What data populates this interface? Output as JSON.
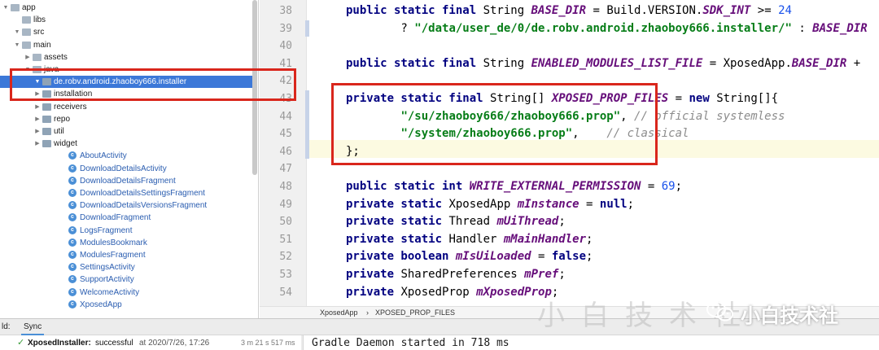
{
  "project_tree": {
    "items": [
      {
        "label": "app",
        "arrow": "▼",
        "icon": "folder-icon",
        "depth": 0
      },
      {
        "label": "libs",
        "arrow": "",
        "icon": "folder-icon",
        "depth": 1
      },
      {
        "label": "src",
        "arrow": "▼",
        "icon": "folder-icon",
        "depth": 1
      },
      {
        "label": "main",
        "arrow": "▼",
        "icon": "folder-icon",
        "depth": 2
      },
      {
        "label": "assets",
        "arrow": "▶",
        "icon": "assets-folder-icon",
        "depth": 3
      },
      {
        "label": "java",
        "arrow": "▼",
        "icon": "source-folder-icon",
        "depth": 3
      },
      {
        "label": "de.robv.android.zhaoboy666.installer",
        "arrow": "▼",
        "icon": "package-icon",
        "depth": 4,
        "selected": true
      },
      {
        "label": "installation",
        "arrow": "▶",
        "icon": "package-icon",
        "depth": 5
      },
      {
        "label": "receivers",
        "arrow": "▶",
        "icon": "package-icon",
        "depth": 5
      },
      {
        "label": "repo",
        "arrow": "▶",
        "icon": "package-icon",
        "depth": 5
      },
      {
        "label": "util",
        "arrow": "▶",
        "icon": "package-icon",
        "depth": 5
      },
      {
        "label": "widget",
        "arrow": "▶",
        "icon": "package-icon",
        "depth": 5
      },
      {
        "label": "AboutActivity",
        "icon": "class-icon",
        "depth": 6
      },
      {
        "label": "DownloadDetailsActivity",
        "icon": "class-icon",
        "depth": 6
      },
      {
        "label": "DownloadDetailsFragment",
        "icon": "class-icon",
        "depth": 6
      },
      {
        "label": "DownloadDetailsSettingsFragment",
        "icon": "class-icon",
        "depth": 6
      },
      {
        "label": "DownloadDetailsVersionsFragment",
        "icon": "class-icon",
        "depth": 6
      },
      {
        "label": "DownloadFragment",
        "icon": "class-icon",
        "depth": 6
      },
      {
        "label": "LogsFragment",
        "icon": "class-icon",
        "depth": 6
      },
      {
        "label": "ModulesBookmark",
        "icon": "class-icon",
        "depth": 6
      },
      {
        "label": "ModulesFragment",
        "icon": "class-icon",
        "depth": 6
      },
      {
        "label": "SettingsActivity",
        "icon": "class-icon",
        "depth": 6
      },
      {
        "label": "SupportActivity",
        "icon": "class-icon",
        "depth": 6
      },
      {
        "label": "WelcomeActivity",
        "icon": "class-icon",
        "depth": 6
      },
      {
        "label": "XposedApp",
        "icon": "class-icon",
        "depth": 6
      }
    ]
  },
  "editor": {
    "lines": [
      {
        "num": "38",
        "tokens": [
          [
            "kw",
            "public static final "
          ],
          [
            "plain",
            "String "
          ],
          [
            "it",
            "BASE_DIR"
          ],
          [
            "plain",
            " = Build.VERSION."
          ],
          [
            "it",
            "SDK_INT"
          ],
          [
            "plain",
            " >= "
          ],
          [
            "num",
            "24"
          ]
        ]
      },
      {
        "num": "39",
        "tokens": [
          [
            "plain",
            "        ? "
          ],
          [
            "str",
            "\"/data/user_de/0/de.robv.android.zhaoboy666.installer/\""
          ],
          [
            "plain",
            " : "
          ],
          [
            "it",
            "BASE_DIR"
          ]
        ]
      },
      {
        "num": "40",
        "tokens": []
      },
      {
        "num": "41",
        "tokens": [
          [
            "kw",
            "public static final "
          ],
          [
            "plain",
            "String "
          ],
          [
            "it",
            "ENABLED_MODULES_LIST_FILE"
          ],
          [
            "plain",
            " = XposedApp."
          ],
          [
            "it",
            "BASE_DIR"
          ],
          [
            "plain",
            " +"
          ]
        ]
      },
      {
        "num": "42",
        "tokens": []
      },
      {
        "num": "43",
        "tokens": [
          [
            "kw",
            "private static final "
          ],
          [
            "plain",
            "String[] "
          ],
          [
            "it",
            "XPOSED_PROP_FILES"
          ],
          [
            "plain",
            " = "
          ],
          [
            "kw",
            "new "
          ],
          [
            "plain",
            "String[]{"
          ]
        ]
      },
      {
        "num": "44",
        "tokens": [
          [
            "plain",
            "        "
          ],
          [
            "str",
            "\"/su/zhaoboy666/zhaoboy666.prop\""
          ],
          [
            "plain",
            ", "
          ],
          [
            "cm",
            "// official systemless"
          ]
        ]
      },
      {
        "num": "45",
        "tokens": [
          [
            "plain",
            "        "
          ],
          [
            "str",
            "\"/system/zhaoboy666.prop\""
          ],
          [
            "plain",
            ",    "
          ],
          [
            "cm",
            "// classical"
          ]
        ]
      },
      {
        "num": "46",
        "tokens": [
          [
            "plain",
            "};"
          ]
        ]
      },
      {
        "num": "47",
        "tokens": []
      },
      {
        "num": "48",
        "tokens": [
          [
            "kw",
            "public static int "
          ],
          [
            "it",
            "WRITE_EXTERNAL_PERMISSION"
          ],
          [
            "plain",
            " = "
          ],
          [
            "num",
            "69"
          ],
          [
            "plain",
            ";"
          ]
        ]
      },
      {
        "num": "49",
        "tokens": [
          [
            "kw",
            "private static "
          ],
          [
            "plain",
            "XposedApp "
          ],
          [
            "it",
            "mInstance"
          ],
          [
            "plain",
            " = "
          ],
          [
            "kw",
            "null"
          ],
          [
            "plain",
            ";"
          ]
        ]
      },
      {
        "num": "50",
        "tokens": [
          [
            "kw",
            "private static "
          ],
          [
            "plain",
            "Thread "
          ],
          [
            "it",
            "mUiThread"
          ],
          [
            "plain",
            ";"
          ]
        ]
      },
      {
        "num": "51",
        "tokens": [
          [
            "kw",
            "private static "
          ],
          [
            "plain",
            "Handler "
          ],
          [
            "it",
            "mMainHandler"
          ],
          [
            "plain",
            ";"
          ]
        ]
      },
      {
        "num": "52",
        "tokens": [
          [
            "kw",
            "private boolean "
          ],
          [
            "it",
            "mIsUiLoaded"
          ],
          [
            "plain",
            " = "
          ],
          [
            "kw",
            "false"
          ],
          [
            "plain",
            ";"
          ]
        ]
      },
      {
        "num": "53",
        "tokens": [
          [
            "kw",
            "private "
          ],
          [
            "plain",
            "SharedPreferences "
          ],
          [
            "it",
            "mPref"
          ],
          [
            "plain",
            ";"
          ]
        ]
      },
      {
        "num": "54",
        "tokens": [
          [
            "kw",
            "private "
          ],
          [
            "plain",
            "XposedProp "
          ],
          [
            "it",
            "mXposedProp"
          ],
          [
            "plain",
            ";"
          ]
        ]
      }
    ]
  },
  "breadcrumb": {
    "class_name": "XposedApp",
    "separator": "›",
    "field_name": "XPOSED_PROP_FILES"
  },
  "build_panel": {
    "tab_prefix": "ld:",
    "sync_tab": "Sync",
    "status_icon": "check-icon",
    "status_project": "XposedInstaller:",
    "status_text": "successful",
    "status_time": "at 2020/7/26, 17:26",
    "duration": "3 m 21 s 517 ms",
    "console_text": "Gradle Daemon started in 718 ms"
  },
  "watermark": {
    "faded_text": "小白技术社",
    "brand": "小白技术社",
    "logo_icon": "wechat-logo-icon"
  },
  "colors": {
    "annotation_red": "#d9261c",
    "selection_blue": "#3c78d8"
  }
}
